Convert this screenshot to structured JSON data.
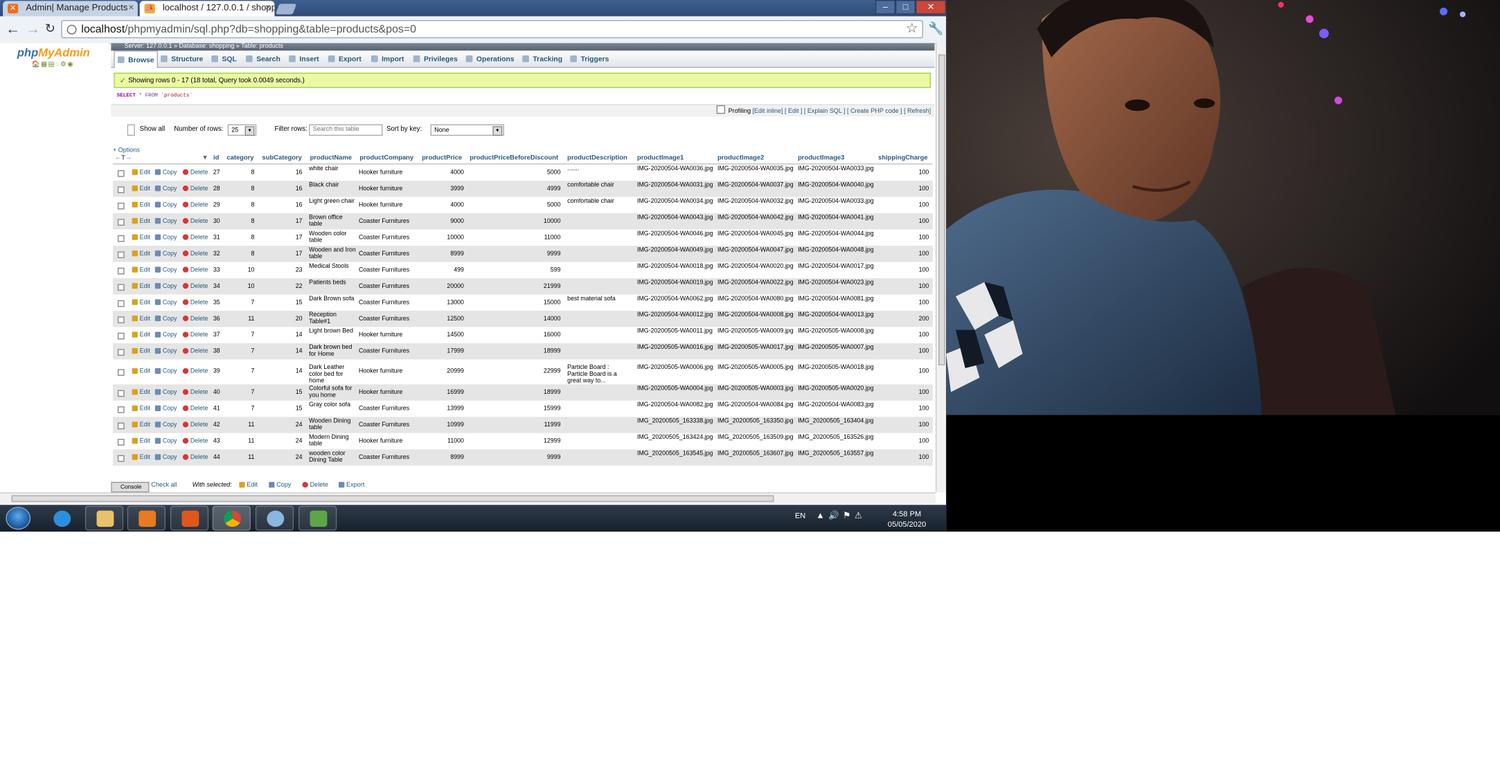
{
  "browser": {
    "tabs": [
      {
        "title": "Admin| Manage Products",
        "icon": "xampp-icon"
      },
      {
        "title": "localhost / 127.0.0.1 / shopp",
        "icon": "phpmyadmin-icon"
      }
    ],
    "url_host": "localhost",
    "url_path": "/phpmyadmin/sql.php?db=shopping&table=products&pos=0"
  },
  "pma": {
    "logo_php": "php",
    "logo_admin": "MyAdmin",
    "breadcrumb": "Server: 127.0.0.1 » Database: shopping » Table: products",
    "tabs": [
      "Browse",
      "Structure",
      "SQL",
      "Search",
      "Insert",
      "Export",
      "Import",
      "Privileges",
      "Operations",
      "Tracking",
      "Triggers"
    ],
    "success_msg": "Showing rows 0 - 17 (18 total, Query took 0.0049 seconds.)",
    "sql_select": "SELECT",
    "sql_star": "* FROM",
    "sql_table": "`products`",
    "profiling": "Profiling",
    "prof_links": "[Edit inline] [ Edit ] [ Explain SQL ] [ Create PHP code ] [ Refresh]",
    "show_all": "Show all",
    "num_rows_label": "Number of rows:",
    "num_rows_value": "25",
    "filter_label": "Filter rows:",
    "filter_placeholder": "Search this table",
    "sort_label": "Sort by key:",
    "sort_value": "None",
    "options": "+ Options",
    "columns": [
      "id",
      "category",
      "subCategory",
      "productName",
      "productCompany",
      "productPrice",
      "productPriceBeforeDiscount",
      "productDescription",
      "productImage1",
      "productImage2",
      "productImage3",
      "shippingCharge"
    ],
    "action_edit": "Edit",
    "action_copy": "Copy",
    "action_delete": "Delete",
    "rows": [
      {
        "id": "27",
        "category": "8",
        "subCategory": "16",
        "name": "white chair",
        "company": "Hooker furniture",
        "price": "4000",
        "before": "5000",
        "desc": ".......",
        "img1": "IMG-20200504-WA0036.jpg",
        "img2": "IMG-20200504-WA0035.jpg",
        "img3": "IMG-20200504-WA0033.jpg",
        "ship": "100"
      },
      {
        "id": "28",
        "category": "8",
        "subCategory": "16",
        "name": "Black chair",
        "company": "Hooker furniture",
        "price": "3999",
        "before": "4999",
        "desc": "comfortable chair",
        "img1": "IMG-20200504-WA0031.jpg",
        "img2": "IMG-20200504-WA0037.jpg",
        "img3": "IMG-20200504-WA0040.jpg",
        "ship": "100"
      },
      {
        "id": "29",
        "category": "8",
        "subCategory": "16",
        "name": "Light green chair",
        "company": "Hooker furniture",
        "price": "4000",
        "before": "5000",
        "desc": "comfortable chair",
        "img1": "IMG-20200504-WA0034.jpg",
        "img2": "IMG-20200504-WA0032.jpg",
        "img3": "IMG-20200504-WA0033.jpg",
        "ship": "100"
      },
      {
        "id": "30",
        "category": "8",
        "subCategory": "17",
        "name": "Brown office table",
        "company": "Coaster Furnitures",
        "price": "9000",
        "before": "10000",
        "desc": "",
        "img1": "IMG-20200504-WA0043.jpg",
        "img2": "IMG-20200504-WA0042.jpg",
        "img3": "IMG-20200504-WA0041.jpg",
        "ship": "100"
      },
      {
        "id": "31",
        "category": "8",
        "subCategory": "17",
        "name": "Wooden color table",
        "company": "Coaster Furnitures",
        "price": "10000",
        "before": "11000",
        "desc": "",
        "img1": "IMG-20200504-WA0046.jpg",
        "img2": "IMG-20200504-WA0045.jpg",
        "img3": "IMG-20200504-WA0044.jpg",
        "ship": "100"
      },
      {
        "id": "32",
        "category": "8",
        "subCategory": "17",
        "name": "Wooden and Iron table",
        "company": "Coaster Furnitures",
        "price": "8999",
        "before": "9999",
        "desc": "",
        "img1": "IMG-20200504-WA0049.jpg",
        "img2": "IMG-20200504-WA0047.jpg",
        "img3": "IMG-20200504-WA0048.jpg",
        "ship": "100"
      },
      {
        "id": "33",
        "category": "10",
        "subCategory": "23",
        "name": "Medical Stools",
        "company": "Coaster Furnitures",
        "price": "499",
        "before": "599",
        "desc": "",
        "img1": "IMG-20200504-WA0018.jpg",
        "img2": "IMG-20200504-WA0020.jpg",
        "img3": "IMG-20200504-WA0017.jpg",
        "ship": "100"
      },
      {
        "id": "34",
        "category": "10",
        "subCategory": "22",
        "name": "Patients beds",
        "company": "Coaster Furnitures",
        "price": "20000",
        "before": "21999",
        "desc": "",
        "img1": "IMG-20200504-WA0019.jpg",
        "img2": "IMG-20200504-WA0022.jpg",
        "img3": "IMG-20200504-WA0023.jpg",
        "ship": "100"
      },
      {
        "id": "35",
        "category": "7",
        "subCategory": "15",
        "name": "Dark Brown sofa",
        "company": "Coaster Furnitures",
        "price": "13000",
        "before": "15000",
        "desc": "best material sofa",
        "img1": "IMG-20200504-WA0062.jpg",
        "img2": "IMG-20200504-WA0080.jpg",
        "img3": "IMG-20200504-WA0081.jpg",
        "ship": "100"
      },
      {
        "id": "36",
        "category": "11",
        "subCategory": "20",
        "name": "Reception Table#1",
        "company": "Coaster Furnitures",
        "price": "12500",
        "before": "14000",
        "desc": "",
        "img1": "IMG-20200504-WA0012.jpg",
        "img2": "IMG-20200504-WA0008.jpg",
        "img3": "IMG-20200504-WA0013.jpg",
        "ship": "200"
      },
      {
        "id": "37",
        "category": "7",
        "subCategory": "14",
        "name": "Light brown Bed",
        "company": "Hooker furniture",
        "price": "14500",
        "before": "16000",
        "desc": "",
        "img1": "IMG-20200505-WA0011.jpg",
        "img2": "IMG-20200505-WA0009.jpg",
        "img3": "IMG-20200505-WA0008.jpg",
        "ship": "100"
      },
      {
        "id": "38",
        "category": "7",
        "subCategory": "14",
        "name": "Dark brown bed for Home",
        "company": "Coaster Furnitures",
        "price": "17999",
        "before": "18999",
        "desc": "",
        "img1": "IMG-20200505-WA0016.jpg",
        "img2": "IMG-20200505-WA0017.jpg",
        "img3": "IMG-20200505-WA0007.jpg",
        "ship": "100"
      },
      {
        "id": "39",
        "category": "7",
        "subCategory": "14",
        "name": "Dark Leather color bed for home",
        "company": "Hooker furniture",
        "price": "20999",
        "before": "22999",
        "desc": "Particle Board : Particle Board is a great way to...",
        "img1": "IMG-20200505-WA0006.jpg",
        "img2": "IMG-20200505-WA0005.jpg",
        "img3": "IMG-20200505-WA0018.jpg",
        "ship": "100"
      },
      {
        "id": "40",
        "category": "7",
        "subCategory": "15",
        "name": "Colorful sofa for you home",
        "company": "Hooker furniture",
        "price": "16999",
        "before": "18999",
        "desc": "",
        "img1": "IMG-20200505-WA0004.jpg",
        "img2": "IMG-20200505-WA0003.jpg",
        "img3": "IMG-20200505-WA0020.jpg",
        "ship": "100"
      },
      {
        "id": "41",
        "category": "7",
        "subCategory": "15",
        "name": "Gray color sofa",
        "company": "Coaster Furnitures",
        "price": "13999",
        "before": "15999",
        "desc": "",
        "img1": "IMG-20200504-WA0082.jpg",
        "img2": "IMG-20200504-WA0084.jpg",
        "img3": "IMG-20200504-WA0083.jpg",
        "ship": "100"
      },
      {
        "id": "42",
        "category": "11",
        "subCategory": "24",
        "name": "Wooden Dining table",
        "company": "Coaster Furnitures",
        "price": "10999",
        "before": "11999",
        "desc": "",
        "img1": "IMG_20200505_163338.jpg",
        "img2": "IMG_20200505_163350.jpg",
        "img3": "IMG_20200505_163404.jpg",
        "ship": "100"
      },
      {
        "id": "43",
        "category": "11",
        "subCategory": "24",
        "name": "Modern Dining table",
        "company": "Hooker furniture",
        "price": "11000",
        "before": "12999",
        "desc": "",
        "img1": "IMG_20200505_163424.jpg",
        "img2": "IMG_20200505_163509.jpg",
        "img3": "IMG_20200505_163526.jpg",
        "ship": "100"
      },
      {
        "id": "44",
        "category": "11",
        "subCategory": "24",
        "name": "wooden color Dining Table",
        "company": "Coaster Furnitures",
        "price": "8999",
        "before": "9999",
        "desc": "",
        "img1": "IMG_20200505_163545.jpg",
        "img2": "IMG_20200505_163607.jpg",
        "img3": "IMG_20200505_163557.jpg",
        "ship": "100"
      }
    ],
    "console": "Console",
    "check_all": "Check all",
    "with_selected": "With selected:",
    "bottom_edit": "Edit",
    "bottom_copy": "Copy",
    "bottom_delete": "Delete",
    "bottom_export": "Export"
  },
  "taskbar": {
    "lang": "EN",
    "time": "4:58 PM",
    "date": "05/05/2020",
    "apps": [
      "internet-explorer-icon",
      "file-explorer-icon",
      "media-player-icon",
      "xampp-icon",
      "chrome-icon",
      "paint-icon",
      "spreadsheet-icon"
    ]
  }
}
